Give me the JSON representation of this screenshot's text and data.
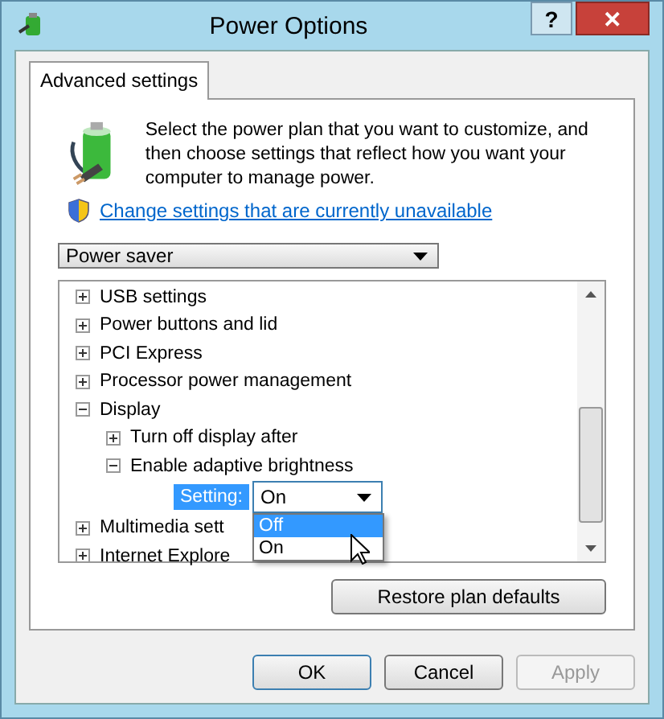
{
  "window": {
    "title": "Power Options",
    "buttons": [
      {
        "kind": "help",
        "label": "?"
      },
      {
        "kind": "close",
        "label": "✕"
      }
    ]
  },
  "tabs": [
    {
      "label": "Advanced settings",
      "selected": true
    }
  ],
  "intro": "Select the power plan that you want to customize, and then choose settings that reflect how you want your computer to manage power.",
  "link": "Change settings that are currently unavailable",
  "plan": {
    "value": "Power saver"
  },
  "tree": [
    {
      "kind": "node",
      "label": "USB settings",
      "expanded": false
    },
    {
      "kind": "node",
      "label": "Power buttons and lid",
      "expanded": false
    },
    {
      "kind": "node",
      "label": "PCI Express",
      "expanded": false
    },
    {
      "kind": "node",
      "label": "Processor power management",
      "expanded": false
    },
    {
      "kind": "node",
      "label": "Display",
      "expanded": true,
      "children": [
        {
          "kind": "node",
          "label": "Turn off display after",
          "expanded": false
        },
        {
          "kind": "node",
          "label": "Enable adaptive brightness",
          "expanded": true,
          "children": [
            {
              "kind": "setting",
              "label": "Setting:",
              "value": "On",
              "options": [
                {
                  "label": "Off",
                  "highlighted": true
                },
                {
                  "label": "On",
                  "highlighted": false
                }
              ]
            }
          ]
        }
      ]
    },
    {
      "kind": "node",
      "label": "Multimedia sett",
      "expanded": false
    },
    {
      "kind": "node",
      "label": "Internet Explore",
      "expanded": false
    }
  ],
  "restore": "Restore plan defaults",
  "footer": [
    {
      "label": "OK",
      "disabled": false
    },
    {
      "label": "Cancel",
      "disabled": false
    },
    {
      "label": "Apply",
      "disabled": true
    }
  ]
}
